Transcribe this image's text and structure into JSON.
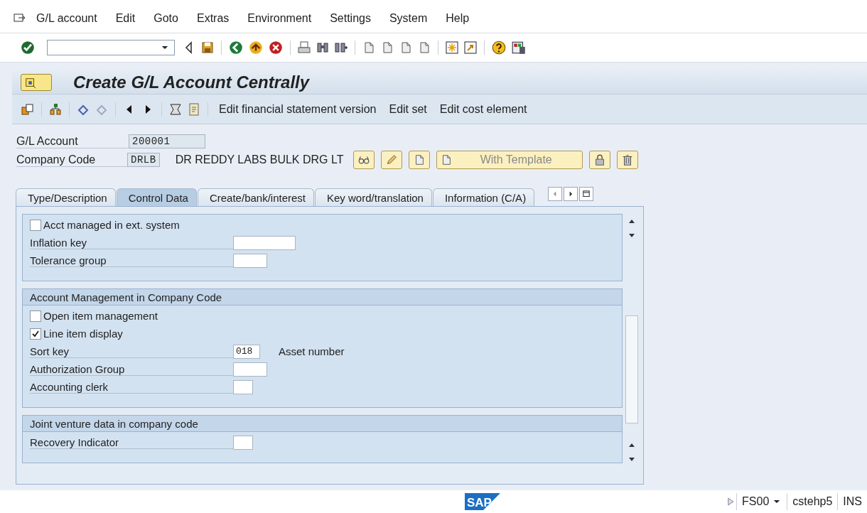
{
  "menu_bar": {
    "items": [
      "G/L account",
      "Edit",
      "Goto",
      "Extras",
      "Environment",
      "Settings",
      "System",
      "Help"
    ]
  },
  "title": "Create G/L Account Centrally",
  "app_toolbar": {
    "buttons": [
      "Edit financial statement version",
      "Edit set",
      "Edit cost element"
    ]
  },
  "header": {
    "gl_account": {
      "label": "G/L Account",
      "value": "200001"
    },
    "company_code": {
      "label": "Company Code",
      "value": "DRLB",
      "name": "DR REDDY LABS BULK DRG LT"
    },
    "template_button": "With Template"
  },
  "tabs": [
    {
      "label": "Type/Description",
      "selected": false
    },
    {
      "label": "Control Data",
      "selected": true
    },
    {
      "label": "Create/bank/interest",
      "selected": false
    },
    {
      "label": "Key word/translation",
      "selected": false
    },
    {
      "label": "Information (C/A)",
      "selected": false
    }
  ],
  "sections": [
    {
      "rows": [
        {
          "kind": "checkbox",
          "label": "Acct managed in ext. system",
          "checked": false
        },
        {
          "kind": "field",
          "label": "Inflation key"
        },
        {
          "kind": "field",
          "label": "Tolerance group"
        }
      ]
    },
    {
      "title": "Account Management in Company Code",
      "rows": [
        {
          "kind": "checkbox",
          "label": "Open item management",
          "checked": false
        },
        {
          "kind": "checkbox",
          "label": "Line item display",
          "checked": true
        },
        {
          "kind": "field",
          "label": "Sort key",
          "value": "018",
          "note": "Asset number"
        },
        {
          "kind": "field",
          "label": "Authorization Group"
        },
        {
          "kind": "field",
          "label": "Accounting clerk"
        }
      ]
    },
    {
      "title": "Joint venture data in company code",
      "rows": [
        {
          "kind": "field",
          "label": "Recovery Indicator"
        }
      ]
    }
  ],
  "status_bar": {
    "logo": "SAP",
    "transaction": "FS00",
    "server": "cstehp5",
    "mode": "INS"
  }
}
